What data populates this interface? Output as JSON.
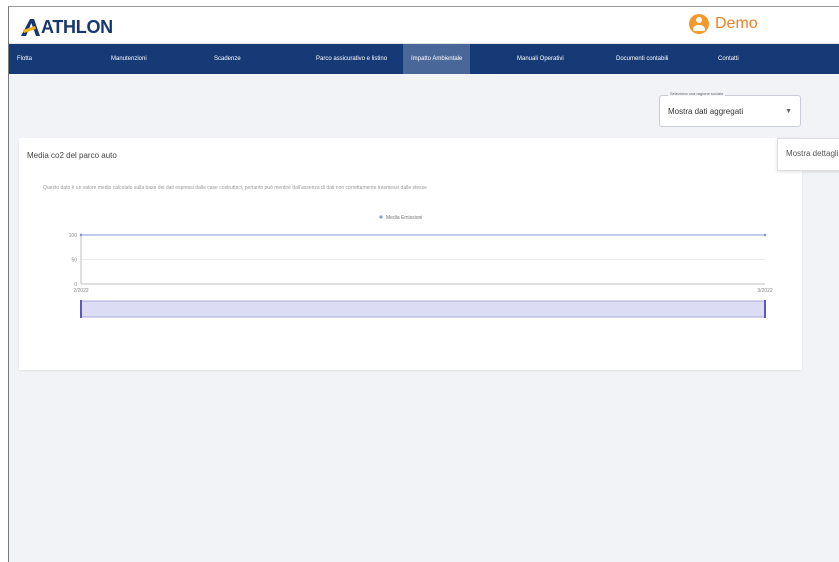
{
  "header": {
    "logo_text": "ATHLON",
    "user_name": "Demo"
  },
  "nav": {
    "items": [
      {
        "label": "Flotta",
        "active": false
      },
      {
        "label": "Manutenzioni",
        "active": false
      },
      {
        "label": "Scadenze",
        "active": false
      },
      {
        "label": "Parco assicurativo e listino",
        "active": false
      },
      {
        "label": "Impatto Ambientale",
        "active": true
      },
      {
        "label": "Manuali Operativi",
        "active": false
      },
      {
        "label": "Documenti contabili",
        "active": false
      },
      {
        "label": "Contatti",
        "active": false
      }
    ]
  },
  "filter": {
    "label": "Seleziona una ragione sociale",
    "value": "Mostra dati aggregati"
  },
  "side_button": {
    "label": "Mostra dettagli"
  },
  "card": {
    "title": "Media co2 del parco auto",
    "note": "Questo dato è un valore medio calcolato sulla base dei dati espressi dalle case costruttrici, pertanto può mentire dall'assenza di dati non correttamente trasmessi dalle stesse"
  },
  "colors": {
    "brand_navy": "#163a76",
    "nav_active": "#4a6799",
    "user_orange": "#e8832a",
    "series_line": "#8a98d6"
  },
  "chart_data": {
    "type": "line",
    "series": [
      {
        "name": "Media Emissioni",
        "x": [
          "2/2022",
          "3/2022"
        ],
        "values": [
          100,
          100
        ]
      }
    ],
    "y_ticks": [
      0,
      50,
      100
    ],
    "x_ticks": [
      "2/2022",
      "3/2022"
    ],
    "ylim": [
      0,
      100
    ],
    "legend": "top-center",
    "grid": true,
    "range_selector": true
  }
}
